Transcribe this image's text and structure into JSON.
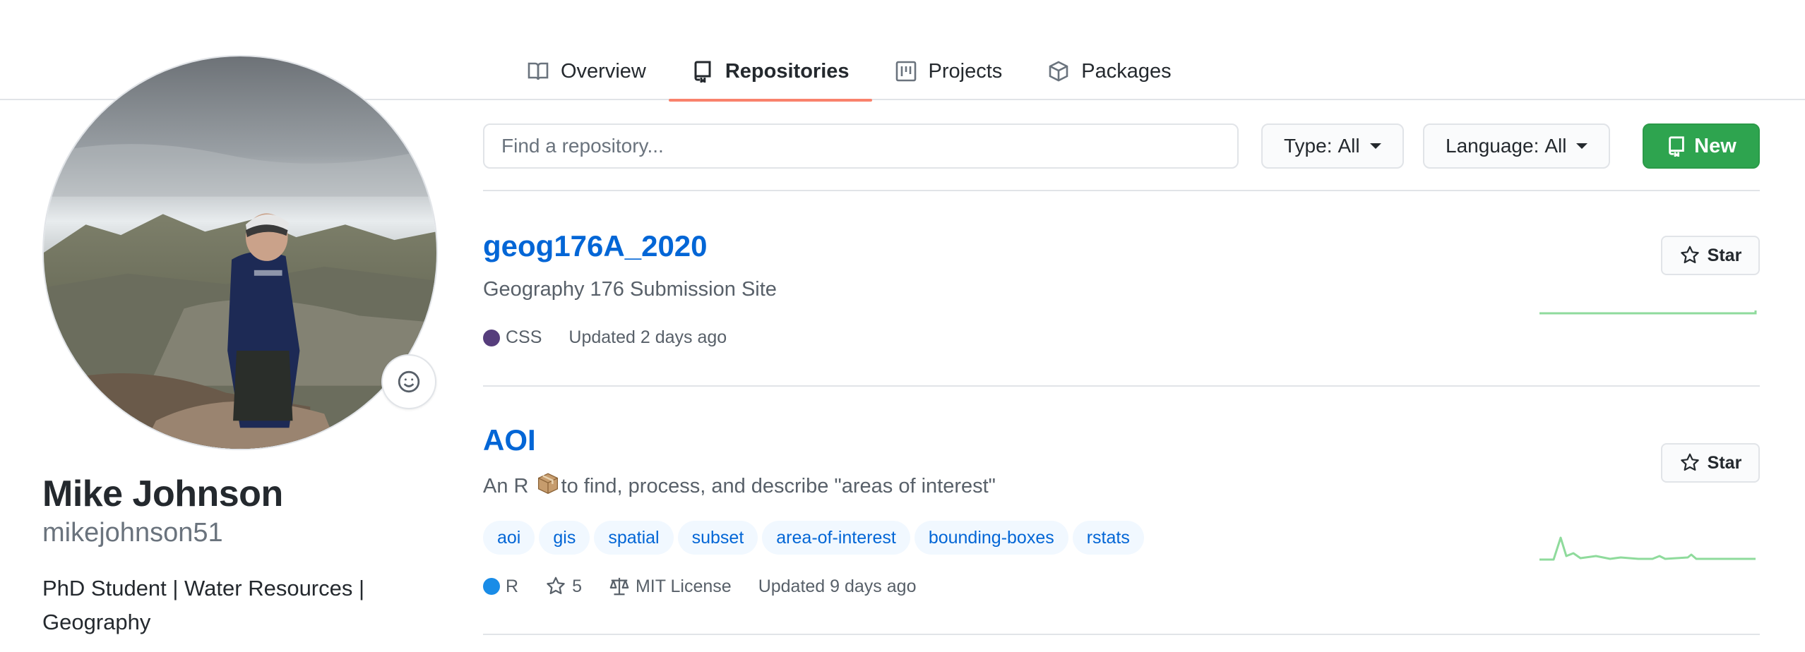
{
  "nav": {
    "tabs": [
      {
        "label": "Overview",
        "icon": "book-icon",
        "active": false
      },
      {
        "label": "Repositories",
        "icon": "repo-icon",
        "active": true
      },
      {
        "label": "Projects",
        "icon": "project-icon",
        "active": false
      },
      {
        "label": "Packages",
        "icon": "package-icon",
        "active": false
      }
    ]
  },
  "profile": {
    "fullname": "Mike Johnson",
    "username": "mikejohnson51",
    "bio": "PhD Student | Water Resources | Geography",
    "status_icon": "smiley-icon"
  },
  "filters": {
    "search_placeholder": "Find a repository...",
    "type_key": "Type:",
    "type_value": "All",
    "language_key": "Language:",
    "language_value": "All",
    "new_label": "New"
  },
  "colors": {
    "accent_tab": "#f9826c",
    "link": "#0366d6",
    "new_button": "#2ea44f",
    "sparkline": "#8fdb9c"
  },
  "repos": [
    {
      "name": "geog176A_2020",
      "description": "Geography 176 Submission Site",
      "language": "CSS",
      "language_color": "#563d7c",
      "updated": "Updated 2 days ago",
      "star_label": "Star"
    },
    {
      "name": "AOI",
      "description_pre": "An R",
      "description_post": "to find, process, and describe \"areas of interest\"",
      "description_icon": "package-emoji",
      "topics": [
        "aoi",
        "gis",
        "spatial",
        "subset",
        "area-of-interest",
        "bounding-boxes",
        "rstats"
      ],
      "language": "R",
      "language_color": "#198ce7",
      "stars": "5",
      "license": "MIT License",
      "updated": "Updated 9 days ago",
      "star_label": "Star"
    }
  ]
}
